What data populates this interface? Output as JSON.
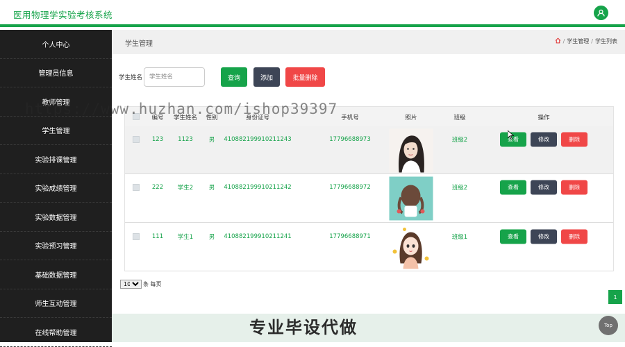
{
  "header": {
    "title": "医用物理学实验考核系统",
    "user_icon": "user-icon"
  },
  "sidebar": {
    "items": [
      {
        "label": "个人中心"
      },
      {
        "label": "管理员信息"
      },
      {
        "label": "教师管理"
      },
      {
        "label": "学生管理"
      },
      {
        "label": "实验排课管理"
      },
      {
        "label": "实验成绩管理"
      },
      {
        "label": "实验数据管理"
      },
      {
        "label": "实验预习管理"
      },
      {
        "label": "基础数据管理"
      },
      {
        "label": "师生互动管理"
      },
      {
        "label": "在线帮助管理"
      }
    ]
  },
  "page": {
    "title": "学生管理",
    "breadcrumb": {
      "home_icon": "home-icon",
      "level1": "学生管理",
      "level2": "学生列表",
      "sep": "/"
    }
  },
  "search": {
    "label": "学生姓名",
    "placeholder": "学生姓名",
    "value": "",
    "query_label": "查询",
    "add_label": "添加",
    "batch_delete_label": "批量删除"
  },
  "table": {
    "columns": [
      "编号",
      "学生姓名",
      "性别",
      "身份证号",
      "手机号",
      "照片",
      "班级",
      "操作"
    ],
    "rows": [
      {
        "id": "123",
        "name": "1123",
        "gender": "男",
        "id_card": "410882199910211243",
        "phone": "17796688973",
        "photo": "student-photo",
        "class": "班级2"
      },
      {
        "id": "222",
        "name": "学生2",
        "gender": "男",
        "id_card": "410882199910211242",
        "phone": "17796688972",
        "photo": "student-photo",
        "class": "班级2"
      },
      {
        "id": "111",
        "name": "学生1",
        "gender": "男",
        "id_card": "410882199910211241",
        "phone": "17796688971",
        "photo": "student-photo",
        "class": "班级1"
      }
    ],
    "actions": {
      "view": "查看",
      "edit": "修改",
      "delete": "删除"
    }
  },
  "pagination": {
    "page_size": "10",
    "page_size_suffix": "条 每页",
    "current_page": "1"
  },
  "overlay": {
    "watermark": "https://www.huzhan.com/ishop39397",
    "banner": "专业毕设代做",
    "top_button": "Top"
  },
  "colors": {
    "brand": "#16a34a",
    "sidebar_bg": "#1f1f1f",
    "danger": "#f04747",
    "dark_button": "#3d4556"
  }
}
